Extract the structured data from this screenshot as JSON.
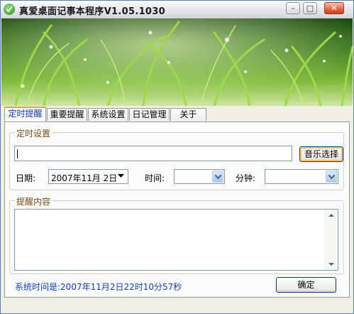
{
  "window": {
    "title": "真爱桌面记事本程序V1.05.1030",
    "controls": {
      "minimize": "–",
      "maximize": "□",
      "close": "✕"
    }
  },
  "tabs": [
    {
      "label": "定时提醒",
      "active": true
    },
    {
      "label": "重要提醒",
      "active": false
    },
    {
      "label": "系统设置",
      "active": false
    },
    {
      "label": "日记管理",
      "active": false
    },
    {
      "label": "关于",
      "active": false
    }
  ],
  "timer_settings": {
    "group_title": "定时设置",
    "music_input_value": "",
    "music_button": "音乐选择",
    "date_label": "日期:",
    "date_value": "2007年11月 2日",
    "time_label": "时间:",
    "time_value": "",
    "minute_label": "分钟:",
    "minute_value": ""
  },
  "reminder": {
    "group_title": "提醒内容",
    "content": ""
  },
  "status": {
    "system_time": "系统时间是:2007年11月2日22时10分57秒"
  },
  "confirm_button": "确定",
  "colors": {
    "accent": "#0b36b0",
    "group_title": "#7a4a1a",
    "status_text": "#1040c0",
    "tab_highlight": "#e6a23c"
  }
}
